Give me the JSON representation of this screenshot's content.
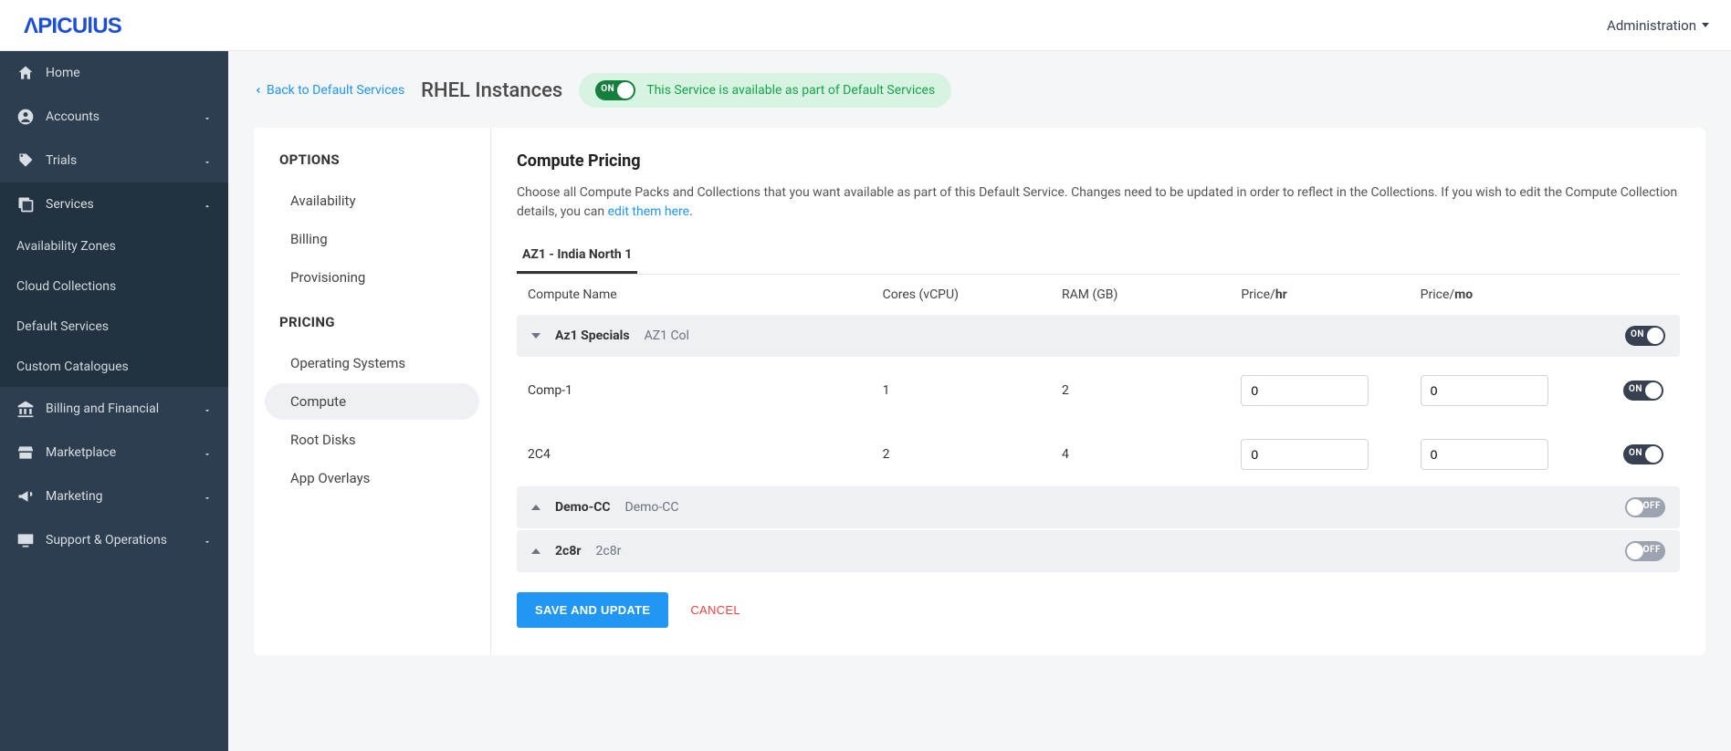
{
  "brand": "APICULUS",
  "topnav": {
    "label": "Administration"
  },
  "sidebar": {
    "items": [
      {
        "label": "Home",
        "icon": "home"
      },
      {
        "label": "Accounts",
        "icon": "user",
        "expandable": true
      },
      {
        "label": "Trials",
        "icon": "tag",
        "expandable": true
      },
      {
        "label": "Services",
        "icon": "layers",
        "expandable": true,
        "open": true,
        "children": [
          {
            "label": "Availability Zones"
          },
          {
            "label": "Cloud Collections"
          },
          {
            "label": "Default Services"
          },
          {
            "label": "Custom Catalogues"
          }
        ]
      },
      {
        "label": "Billing and Financial",
        "icon": "bank",
        "expandable": true
      },
      {
        "label": "Marketplace",
        "icon": "store",
        "expandable": true
      },
      {
        "label": "Marketing",
        "icon": "megaphone",
        "expandable": true
      },
      {
        "label": "Support & Operations",
        "icon": "monitor",
        "expandable": true
      }
    ]
  },
  "page": {
    "back_label": "Back to Default Services",
    "title": "RHEL Instances",
    "toggle_state": "ON",
    "status_text": "This Service is available as part of Default Services"
  },
  "options_panel": {
    "heading_options": "OPTIONS",
    "heading_pricing": "PRICING",
    "options": [
      {
        "label": "Availability"
      },
      {
        "label": "Billing"
      },
      {
        "label": "Provisioning"
      }
    ],
    "pricing": [
      {
        "label": "Operating Systems"
      },
      {
        "label": "Compute",
        "active": true
      },
      {
        "label": "Root Disks"
      },
      {
        "label": "App Overlays"
      }
    ]
  },
  "content": {
    "title": "Compute Pricing",
    "description_pre": "Choose all Compute Packs and Collections that you want available as part of this Default Service. Changes need to be updated in order to reflect in the Collections. If you wish to edit the Compute Collection details, you can ",
    "description_link": "edit them here",
    "description_post": ".",
    "tab": "AZ1 - India North 1",
    "columns": {
      "c1": "Compute Name",
      "c2": "Cores (vCPU)",
      "c3": "RAM (GB)",
      "c4_pre": "Price/",
      "c4_b": "hr",
      "c5_pre": "Price/",
      "c5_b": "mo"
    },
    "groups": [
      {
        "name": "Az1 Specials",
        "sub": "AZ1 Col",
        "expanded": true,
        "toggle": "ON",
        "rows": [
          {
            "name": "Comp-1",
            "cores": "1",
            "ram": "2",
            "price_hr": "0",
            "price_mo": "0",
            "toggle": "ON"
          },
          {
            "name": "2C4",
            "cores": "2",
            "ram": "4",
            "price_hr": "0",
            "price_mo": "0",
            "toggle": "ON"
          }
        ]
      },
      {
        "name": "Demo-CC",
        "sub": "Demo-CC",
        "expanded": false,
        "toggle": "OFF"
      },
      {
        "name": "2c8r",
        "sub": "2c8r",
        "expanded": false,
        "toggle": "OFF"
      }
    ],
    "actions": {
      "save": "SAVE AND UPDATE",
      "cancel": "CANCEL"
    }
  }
}
